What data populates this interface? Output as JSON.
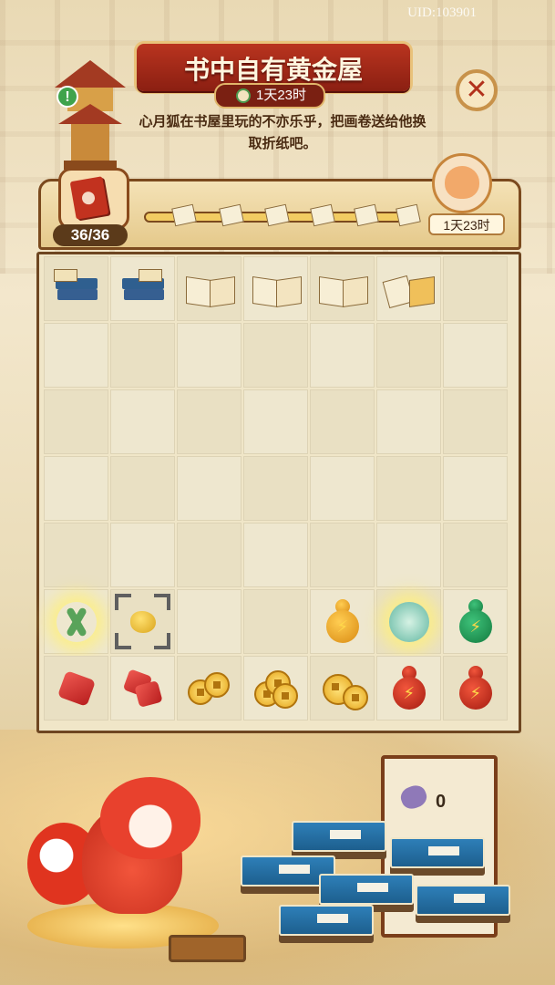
{
  "header": {
    "uid": "UID:103901",
    "title": "书中自有黄金屋",
    "timer": "1天23时",
    "description": "心月狐在书屋里玩的不亦乐乎，把画卷送给他换取折纸吧。"
  },
  "progress": {
    "count": "36/36",
    "fox_timer": "1天23时",
    "milestones": 6
  },
  "board": {
    "rows": 7,
    "cols": 7,
    "row1": [
      "books-stack-1",
      "books-stack-2",
      "books-open-1",
      "books-open-2",
      "books-open-3",
      "books-paper",
      ""
    ],
    "row6": [
      "scissors-glow",
      "gold-nugget-selected",
      "",
      "",
      "orange-gourd",
      "jade-orb-glow",
      "green-gourd"
    ],
    "row7": [
      "red-gem",
      "red-gems-pair",
      "coins-small",
      "coins-medium",
      "coins-large",
      "red-gourd",
      "red-gourd"
    ]
  },
  "inventory": {
    "paint_count": "0"
  },
  "icons": {
    "close": "close-icon",
    "alert": "exclamation-icon",
    "clock": "clock-icon"
  },
  "colors": {
    "banner_red": "#b9341f",
    "frame_brown": "#7b4a1e",
    "board_bg": "#f0e6c8"
  }
}
